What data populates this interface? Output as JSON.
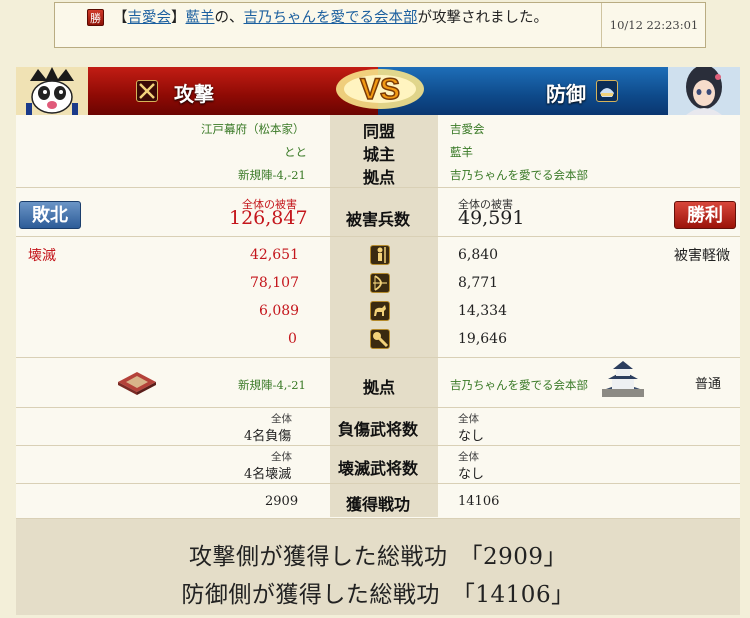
{
  "notice": {
    "badge": "勝",
    "bracket_open": "【",
    "alliance": "吉愛会",
    "bracket_close": "】",
    "player": "藍羊",
    "connector": "の、",
    "target": "吉乃ちゃんを愛でる会本部",
    "suffix": "が攻撃されました。",
    "timestamp": "10/12 22:23:01"
  },
  "header": {
    "attack_title": "攻撃",
    "defense_title": "防御",
    "vs_text": "VS"
  },
  "info": {
    "alliance_label": "同盟",
    "lord_label": "城主",
    "base_label": "拠点",
    "attacker_alliance": "江戸幕府（松本家）",
    "attacker_lord": "とと",
    "attacker_base": "新規陣-4,-21",
    "defender_alliance": "吉愛会",
    "defender_lord": "藍羊",
    "defender_base": "吉乃ちゃんを愛でる会本部"
  },
  "damage": {
    "result_attacker": "敗北",
    "result_defender": "勝利",
    "label": "被害兵数",
    "attacker_total_label": "全体の被害",
    "attacker_total": "126,847",
    "defender_total_label": "全体の被害",
    "defender_total": "49,591",
    "attacker_status": "壊滅",
    "defender_status": "被害軽微",
    "units": [
      {
        "icon": "spear-infantry-icon",
        "attacker": "42,651",
        "defender": "6,840"
      },
      {
        "icon": "bow-archer-icon",
        "attacker": "78,107",
        "defender": "8,771"
      },
      {
        "icon": "horse-cavalry-icon",
        "attacker": "6,089",
        "defender": "14,334"
      },
      {
        "icon": "siege-weapon-icon",
        "attacker": "0",
        "defender": "19,646"
      }
    ]
  },
  "base": {
    "label": "拠点",
    "attacker_base": "新規陣-4,-21",
    "defender_base": "吉乃ちゃんを愛でる会本部",
    "defender_status": "普通"
  },
  "generals": {
    "wounded_label": "負傷武将数",
    "destroyed_label": "壊滅武将数",
    "scope": "全体",
    "attacker_wounded": "4名負傷",
    "defender_wounded": "なし",
    "attacker_destroyed": "4名壊滅",
    "defender_destroyed": "なし"
  },
  "merit": {
    "label": "獲得戦功",
    "attacker": "2909",
    "defender": "14106"
  },
  "summary": {
    "attacker_line": "攻撃側が獲得した総戦功　「2909」",
    "defender_line": "防御側が獲得した総戦功　「14106」"
  },
  "colors": {
    "attack_red": "#c21d14",
    "defense_blue": "#1e6eb8",
    "link_blue": "#1b5f9f",
    "green_text": "#3a7a27",
    "damage_red": "#c4161c"
  }
}
